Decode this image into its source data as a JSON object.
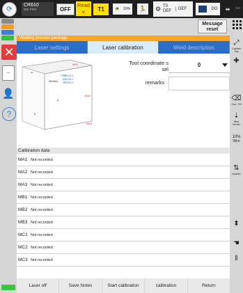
{
  "topbar": {
    "robot_name": "CR610",
    "robot_sub": "800 PRO",
    "off_label": "OFF",
    "read_label": "Read",
    "read_sub": "v",
    "mode_label": "T1",
    "speed_label": "10%",
    "tool_top": "T0",
    "tool_bottom": "DEF",
    "def_label": "DEF",
    "do_label": "DO",
    "out_label": "out"
  },
  "left": {
    "help_glyph": "?"
  },
  "main": {
    "message_reset": "Message reset",
    "title": "Welding process package",
    "tabs": [
      {
        "label": "Laser settings"
      },
      {
        "label": "Laser calibration"
      },
      {
        "label": "Weld description"
      }
    ],
    "tool_coord_label": "Tool coordinate system selection",
    "tool_coord_value": "0",
    "remarks_label": "remarks",
    "remarks_value": "",
    "diagram_labels": {
      "ma1": "MA1",
      "ma2": "MA2",
      "ma3": "MA3",
      "mb1": "MB1/MC1",
      "mb2": "MB2/MC2",
      "mb3": "MB3/MC3",
      "weldline": "Weldline"
    },
    "calibration_header": "Calibration data",
    "calibration_rows": [
      {
        "name": "MA1",
        "status": "Not recorded"
      },
      {
        "name": "MA2",
        "status": "Not recorded"
      },
      {
        "name": "MA3",
        "status": "Not recorded"
      },
      {
        "name": "MB1",
        "status": "Not recorded"
      },
      {
        "name": "MB2",
        "status": "Not recorded"
      },
      {
        "name": "MB3",
        "status": "Not recorded"
      },
      {
        "name": "MC1",
        "status": "Not recorded"
      },
      {
        "name": "MC2",
        "status": "Not recorded"
      },
      {
        "name": "MC3",
        "status": "Not recorded"
      }
    ],
    "footer_buttons": [
      {
        "label": "Laser off"
      },
      {
        "label": "Save Notes"
      },
      {
        "label": "Start calibration"
      },
      {
        "label": "calibration"
      },
      {
        "label": "Return"
      }
    ]
  },
  "rightbar": {
    "custom_label": "Custom Top",
    "coor_label": "Coo. Off",
    "wire_feed_label": "Wire feedin",
    "wire_pct": "10%",
    "wire_label": "Wire",
    "replace_label": "replace"
  },
  "colors": {
    "tab_blue": "#2b6cc4",
    "tab_active": "#d9ecfa",
    "title_orange": "#f4a52a",
    "read_yellow": "#ffe10a",
    "close_red": "#e53b3b"
  }
}
